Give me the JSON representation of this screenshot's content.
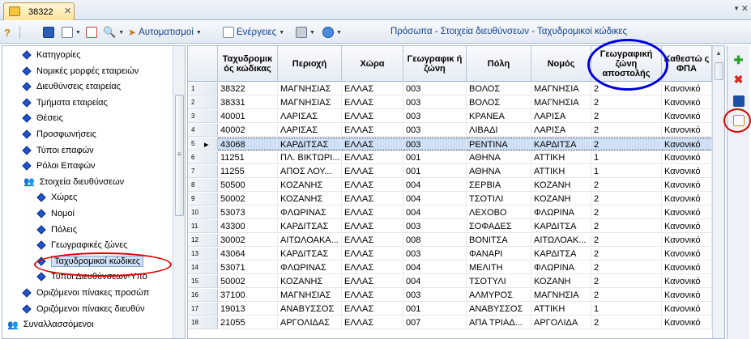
{
  "tab": {
    "title": "38322",
    "close_glyph": "✕"
  },
  "toolbar": {
    "automations_label": "Αυτοματισμοί",
    "actions_label": "Ενέργειες",
    "breadcrumb": "Πρόσωπα - Στοιχεία διευθύνσεων - Ταχυδρομικοί κώδικες"
  },
  "tree": [
    {
      "label": "Κατηγορίες",
      "level": 1,
      "icon": "diamond-icon"
    },
    {
      "label": "Νομικές μορφές εταιρειών",
      "level": 1,
      "icon": "diamond-icon"
    },
    {
      "label": "Διευθύνσεις εταιρείας",
      "level": 1,
      "icon": "diamond-icon"
    },
    {
      "label": "Τμήματα εταιρείας",
      "level": 1,
      "icon": "diamond-icon"
    },
    {
      "label": "Θέσεις",
      "level": 1,
      "icon": "diamond-icon"
    },
    {
      "label": "Προσφωνήσεις",
      "level": 1,
      "icon": "diamond-icon"
    },
    {
      "label": "Τύποι επαφών",
      "level": 1,
      "icon": "diamond-icon"
    },
    {
      "label": "Ρόλοι Επαφών",
      "level": 1,
      "icon": "diamond-icon"
    },
    {
      "label": "Στοιχεία διευθύνσεων",
      "level": 1,
      "icon": "people-folder-icon"
    },
    {
      "label": "Χώρες",
      "level": 2,
      "icon": "diamond-icon"
    },
    {
      "label": "Νομοί",
      "level": 2,
      "icon": "diamond-icon"
    },
    {
      "label": "Πόλεις",
      "level": 2,
      "icon": "diamond-icon"
    },
    {
      "label": "Γεωγραφικές ζώνες",
      "level": 2,
      "icon": "diamond-icon"
    },
    {
      "label": "Ταχυδρομικοί κώδικες",
      "level": 2,
      "icon": "diamond-icon",
      "selected": true
    },
    {
      "label": "Τύποι Διευθύνσεων-Υπο",
      "level": 2,
      "icon": "diamond-icon"
    },
    {
      "label": "Οριζόμενοι πίνακες προσώπ",
      "level": 1,
      "icon": "diamond-icon"
    },
    {
      "label": "Οριζόμενοι πίνακες διευθύν",
      "level": 1,
      "icon": "diamond-icon"
    },
    {
      "label": "Συναλλασσόμενοι",
      "level": 0,
      "icon": "people-folder-icon"
    }
  ],
  "grid": {
    "columns": [
      "Ταχυδρομικ ός κώδικας",
      "Περιοχή",
      "Χώρα",
      "Γεωγραφικ ή ζώνη",
      "Πόλη",
      "Νομός",
      "Γεωγραφική ζώνη αποστολής",
      "Καθεστώ ς ΦΠΑ"
    ],
    "selected_row": 5,
    "rows": [
      [
        "1",
        "38322",
        "ΜΑΓΝΗΣΙΑΣ",
        "ΕΛΛΑΣ",
        "003",
        "ΒΟΛΟΣ",
        "ΜΑΓΝΗΣΙΑ",
        "2",
        "Κανονικό"
      ],
      [
        "2",
        "38331",
        "ΜΑΓΝΗΣΙΑΣ",
        "ΕΛΛΑΣ",
        "003",
        "ΒΟΛΟΣ",
        "ΜΑΓΝΗΣΙΑ",
        "2",
        "Κανονικό"
      ],
      [
        "3",
        "40001",
        "ΛΑΡΙΣΑΣ",
        "ΕΛΛΑΣ",
        "003",
        "ΚΡΑΝΕΑ",
        "ΛΑΡΙΣΑ",
        "2",
        "Κανονικό"
      ],
      [
        "4",
        "40002",
        "ΛΑΡΙΣΑΣ",
        "ΕΛΛΑΣ",
        "003",
        "ΛΙΒΑΔΙ",
        "ΛΑΡΙΣΑ",
        "2",
        "Κανονικό"
      ],
      [
        "5",
        "43068",
        "ΚΑΡΔΙΤΣΑΣ",
        "ΕΛΛΑΣ",
        "003",
        "ΡΕΝΤΙΝΑ",
        "ΚΑΡΔΙΤΣΑ",
        "2",
        "Κανονικό"
      ],
      [
        "6",
        "11251",
        "ΠΛ. ΒΙΚΤΩΡΙ...",
        "ΕΛΛΑΣ",
        "001",
        "ΑΘΗΝΑ",
        "ΑΤΤΙΚΗ",
        "1",
        "Κανονικό"
      ],
      [
        "7",
        "11255",
        "ΑΠΟΣ ΛΟΥ...",
        "ΕΛΛΑΣ",
        "001",
        "ΑΘΗΝΑ",
        "ΑΤΤΙΚΗ",
        "1",
        "Κανονικό"
      ],
      [
        "8",
        "50500",
        "ΚΟΖΑΝΗΣ",
        "ΕΛΛΑΣ",
        "004",
        "ΣΕΡΒΙΑ",
        "ΚΟΖΑΝΗ",
        "2",
        "Κανονικό"
      ],
      [
        "9",
        "50002",
        "ΚΟΖΑΝΗΣ",
        "ΕΛΛΑΣ",
        "004",
        "ΤΣΟΤΙΛΙ",
        "ΚΟΖΑΝΗ",
        "2",
        "Κανονικό"
      ],
      [
        "10",
        "53073",
        "ΦΛΩΡΙΝΑΣ",
        "ΕΛΛΑΣ",
        "004",
        "ΛΕΧΟΒΟ",
        "ΦΛΩΡΙΝΑ",
        "2",
        "Κανονικό"
      ],
      [
        "11",
        "43300",
        "ΚΑΡΔΙΤΣΑΣ",
        "ΕΛΛΑΣ",
        "003",
        "ΣΟΦΑΔΕΣ",
        "ΚΑΡΔΙΤΣΑ",
        "2",
        "Κανονικό"
      ],
      [
        "12",
        "30002",
        "ΑΙΤΩΛΟΑΚΑ...",
        "ΕΛΛΑΣ",
        "008",
        "ΒΟΝΙΤΣΑ",
        "ΑΙΤΩΛΟΑΚ...",
        "2",
        "Κανονικό"
      ],
      [
        "13",
        "43064",
        "ΚΑΡΔΙΤΣΑΣ",
        "ΕΛΛΑΣ",
        "003",
        "ΦΑΝΑΡΙ",
        "ΚΑΡΔΙΤΣΑ",
        "2",
        "Κανονικό"
      ],
      [
        "14",
        "53071",
        "ΦΛΩΡΙΝΑΣ",
        "ΕΛΛΑΣ",
        "004",
        "ΜΕΛΙΤΗ",
        "ΦΛΩΡΙΝΑ",
        "2",
        "Κανονικό"
      ],
      [
        "15",
        "50002",
        "ΚΟΖΑΝΗΣ",
        "ΕΛΛΑΣ",
        "004",
        "ΤΣΟΤΥΛΙ",
        "ΚΟΖΑΝΗ",
        "2",
        "Κανονικό"
      ],
      [
        "16",
        "37100",
        "ΜΑΓΝΗΣΙΑΣ",
        "ΕΛΛΑΣ",
        "003",
        "ΑΛΜΥΡΟΣ",
        "ΜΑΓΝΗΣΙΑ",
        "2",
        "Κανονικό"
      ],
      [
        "17",
        "19013",
        "ΑΝΑΒΥΣΣΟΣ",
        "ΕΛΛΑΣ",
        "001",
        "ΑΝΑΒΥΣΣΟΣ",
        "ΑΤΤΙΚΗ",
        "1",
        "Κανονικό"
      ],
      [
        "18",
        "21055",
        "ΑΡΓΟΛΙΔΑΣ",
        "ΕΛΛΑΣ",
        "007",
        "ΑΠΑ ΤΡΙΑΔ...",
        "ΑΡΓΟΛΙΔΑ",
        "2",
        "Κανονικό"
      ]
    ]
  },
  "side_buttons": [
    {
      "name": "add-button",
      "glyph": "✚",
      "color": "#2aa52a"
    },
    {
      "name": "delete-button",
      "glyph": "✖",
      "color": "#d42a1e"
    },
    {
      "name": "save-button",
      "glyph": "",
      "color": "#1e4fa8"
    },
    {
      "name": "edit-button",
      "glyph": "",
      "color": "#b08c2c"
    }
  ],
  "highlight_colors": {
    "blue_ring": "#0000dd",
    "red_ring": "#dd0000"
  }
}
